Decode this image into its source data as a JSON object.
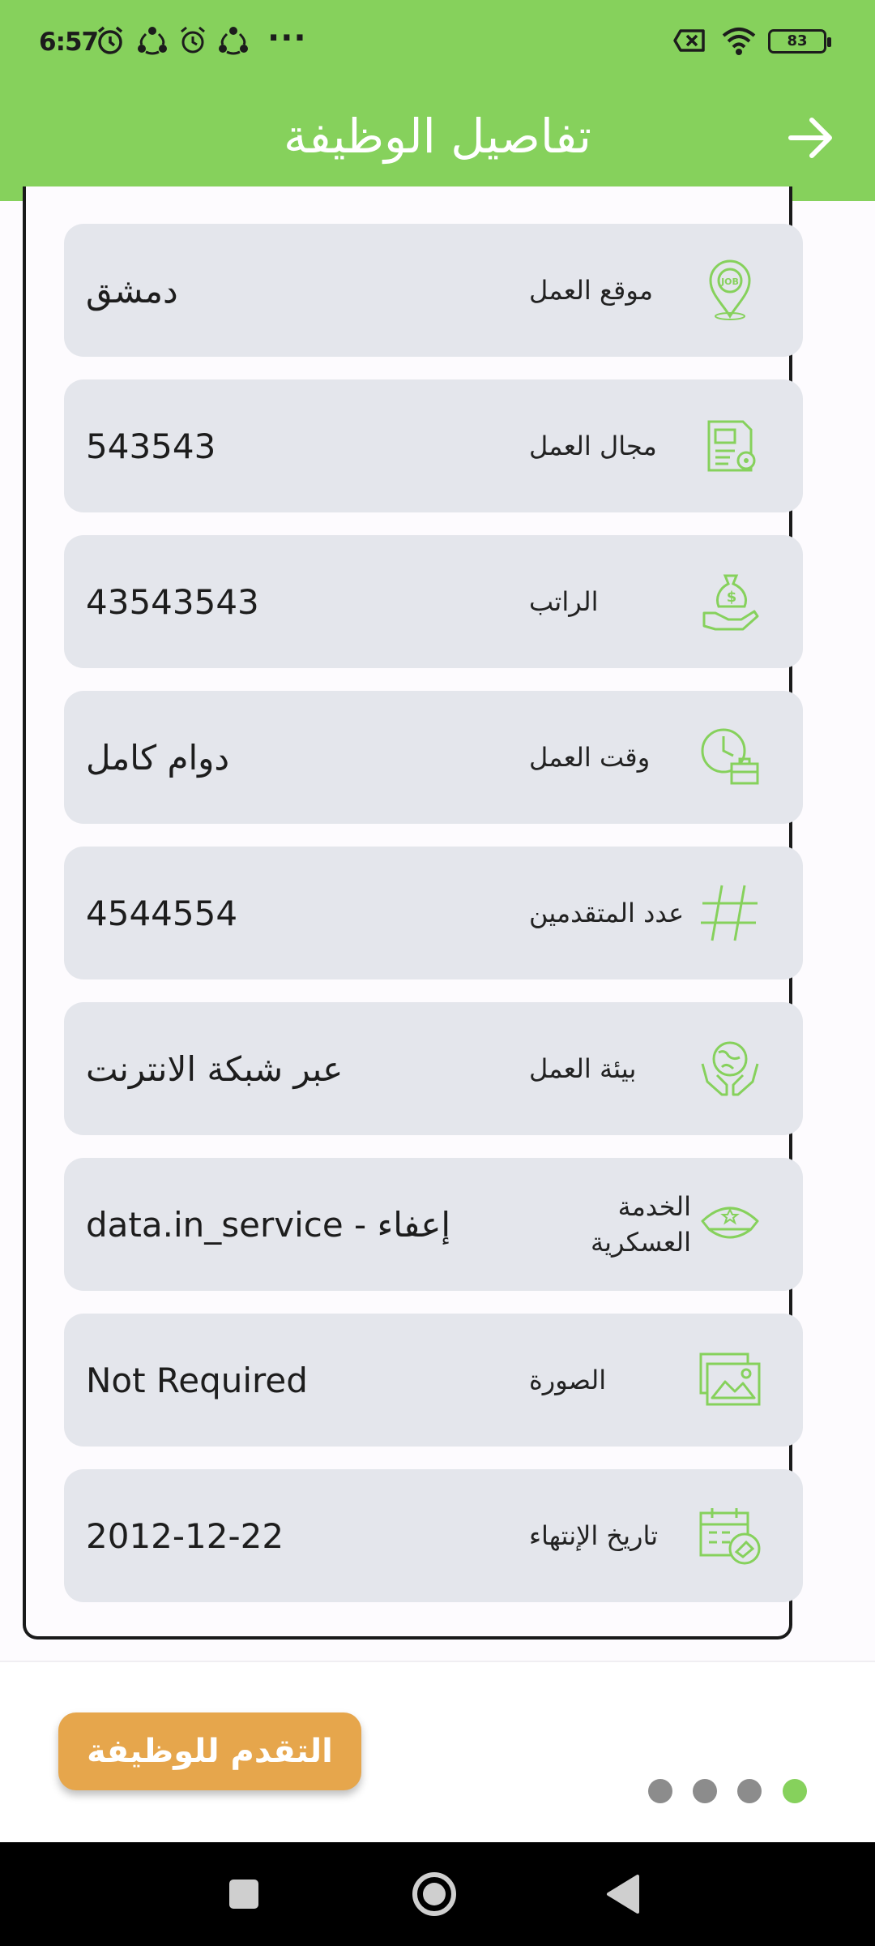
{
  "status_bar": {
    "time": "6:57",
    "battery": "83",
    "more": "···",
    "icons": [
      "alarm-icon",
      "share-icon",
      "alarm-icon",
      "share-icon",
      "sim-off-icon",
      "wifi-icon",
      "battery-icon"
    ]
  },
  "app_bar": {
    "title": "تفاصيل الوظيفة",
    "back_icon": "arrow-right-icon"
  },
  "details": [
    {
      "label": "موقع العمل",
      "value": "دمشق",
      "icon": "job-location-icon"
    },
    {
      "label": "مجال العمل",
      "value": "543543",
      "icon": "work-field-icon"
    },
    {
      "label": "الراتب",
      "value": "43543543",
      "icon": "salary-icon"
    },
    {
      "label": "وقت العمل",
      "value": "دوام كامل",
      "icon": "work-time-icon"
    },
    {
      "label": "عدد المتقدمين",
      "value": "4544554",
      "icon": "hashtag-icon"
    },
    {
      "label": "بيئة العمل",
      "value": "عبر شبكة الانترنت",
      "icon": "globe-hands-icon"
    },
    {
      "label": "الخدمة العسكرية",
      "value": "إعفاء - data.in_service",
      "icon": "military-cap-icon"
    },
    {
      "label": "الصورة",
      "value": "Not Required",
      "icon": "image-icon"
    },
    {
      "label": "تاريخ الإنتهاء",
      "value": "2012-12-22",
      "icon": "calendar-icon"
    }
  ],
  "bottom": {
    "apply_label": "التقدم للوظيفة",
    "pager": {
      "count": 4,
      "active_index": 3
    }
  },
  "colors": {
    "primary_green": "#86d15c",
    "accent_orange": "#e6a64c",
    "card_bg": "#e4e6ec",
    "dot_inactive": "#8c8c8c",
    "dot_active": "#86d15c"
  },
  "nav_bar": {
    "items": [
      "recents-square-icon",
      "home-circle-icon",
      "back-triangle-icon"
    ]
  }
}
